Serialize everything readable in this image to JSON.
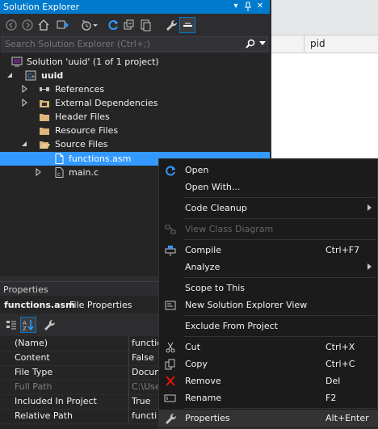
{
  "solution_explorer": {
    "title": "Solution Explorer",
    "search_placeholder": "Search Solution Explorer (Ctrl+;)",
    "tree": [
      {
        "label": "Solution 'uuid' (1 of 1 project)",
        "icon": "solution-icon"
      },
      {
        "label": "uuid",
        "icon": "project-icon"
      },
      {
        "label": "References",
        "icon": "references-icon"
      },
      {
        "label": "External Dependencies",
        "icon": "folder-icon"
      },
      {
        "label": "Header Files",
        "icon": "folder-icon"
      },
      {
        "label": "Resource Files",
        "icon": "folder-icon"
      },
      {
        "label": "Source Files",
        "icon": "folder-open-icon"
      },
      {
        "label": "functions.asm",
        "icon": "file-icon",
        "selected": true
      },
      {
        "label": "main.c",
        "icon": "c-file-icon"
      }
    ]
  },
  "editor": {
    "column_header": "pid"
  },
  "properties": {
    "title": "Properties",
    "object_name": "functions.asm",
    "object_type": "File Properties",
    "rows": [
      {
        "key": "(Name)",
        "value": "functio"
      },
      {
        "key": "Content",
        "value": "False"
      },
      {
        "key": "File Type",
        "value": "Docum"
      },
      {
        "key": "Full Path",
        "value": "C:\\Use",
        "dim": true
      },
      {
        "key": "Included In Project",
        "value": "True"
      },
      {
        "key": "Relative Path",
        "value": "functi"
      }
    ]
  },
  "context_menu": {
    "items": [
      {
        "label": "Open",
        "shortcut": "",
        "icon": "open-icon"
      },
      {
        "label": "Open With...",
        "shortcut": ""
      },
      {
        "label": "Code Cleanup",
        "shortcut": "",
        "submenu": true
      },
      {
        "label": "View Class Diagram",
        "shortcut": "",
        "disabled": true,
        "icon": "class-diagram-icon"
      },
      {
        "label": "Compile",
        "shortcut": "Ctrl+F7",
        "icon": "compile-icon"
      },
      {
        "label": "Analyze",
        "shortcut": "",
        "submenu": true
      },
      {
        "label": "Scope to This",
        "shortcut": ""
      },
      {
        "label": "New Solution Explorer View",
        "shortcut": "",
        "icon": "new-view-icon"
      },
      {
        "label": "Exclude From Project",
        "shortcut": ""
      },
      {
        "label": "Cut",
        "shortcut": "Ctrl+X",
        "icon": "cut-icon"
      },
      {
        "label": "Copy",
        "shortcut": "Ctrl+C",
        "icon": "copy-icon"
      },
      {
        "label": "Remove",
        "shortcut": "Del",
        "icon": "remove-icon"
      },
      {
        "label": "Rename",
        "shortcut": "F2",
        "icon": "rename-icon"
      },
      {
        "label": "Properties",
        "shortcut": "Alt+Enter",
        "icon": "wrench-icon",
        "highlighted": true
      }
    ]
  },
  "colors": {
    "accent": "#007acc",
    "selection": "#3399ff",
    "background": "#2d2d30"
  }
}
